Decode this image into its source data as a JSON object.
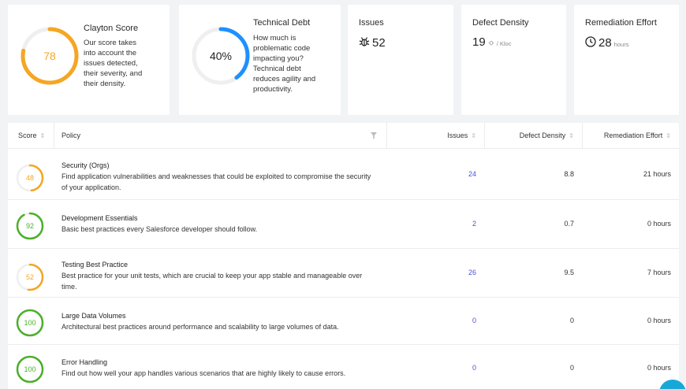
{
  "cards": {
    "score": {
      "value": "78",
      "fraction": 0.78,
      "title": "Clayton Score",
      "description": [
        "Our score takes",
        "into account the",
        "issues detected,",
        "their severity, and",
        "their density."
      ],
      "color": "#f5a623"
    },
    "debt": {
      "value": "40%",
      "fraction": 0.4,
      "title": "Technical Debt",
      "description": [
        "How much is",
        "problematic code",
        "impacting you?",
        "Technical debt",
        "reduces agility and",
        "productivity."
      ],
      "color": "#1e90ff"
    },
    "issues": {
      "title": "Issues",
      "value": "52",
      "icon": "bug-icon"
    },
    "density": {
      "title": "Defect Density",
      "value": "19",
      "unit": "/ Kloc",
      "icon": "bug-icon"
    },
    "remediation": {
      "title": "Remediation Effort",
      "value": "28",
      "unit": "hours",
      "icon": "clock-icon"
    }
  },
  "table": {
    "headers": {
      "score": "Score",
      "policy": "Policy",
      "issues": "Issues",
      "density": "Defect Density",
      "remediation": "Remediation Effort"
    },
    "rows": [
      {
        "score": "48",
        "score_fraction": 0.48,
        "color": "#f5a623",
        "title": "Security (Orgs)",
        "desc": [
          "Find application vulnerabilities and weaknesses that could be exploited to compromise the security",
          "of your application."
        ],
        "issues": "24",
        "density": "8.8",
        "remediation": "21 hours"
      },
      {
        "score": "92",
        "score_fraction": 0.92,
        "color": "#4caf2a",
        "title": "Development Essentials",
        "desc": [
          "Basic best practices every Salesforce developer should follow."
        ],
        "issues": "2",
        "density": "0.7",
        "remediation": "0 hours"
      },
      {
        "score": "52",
        "score_fraction": 0.52,
        "color": "#f5a623",
        "title": "Testing Best Practice",
        "desc": [
          "Best practice for your unit tests, which are crucial to keep your app stable and manageable over",
          "time."
        ],
        "issues": "26",
        "density": "9.5",
        "remediation": "7 hours"
      },
      {
        "score": "100",
        "score_fraction": 1.0,
        "color": "#4caf2a",
        "title": "Large Data Volumes",
        "desc": [
          "Architectural best practices around performance and scalability to large volumes of data."
        ],
        "issues": "0",
        "density": "0",
        "remediation": "0 hours"
      },
      {
        "score": "100",
        "score_fraction": 1.0,
        "color": "#4caf2a",
        "title": "Error Handling",
        "desc": [
          "Find out how well your app handles various scenarios that are highly likely to cause errors."
        ],
        "issues": "0",
        "density": "0",
        "remediation": "0 hours"
      }
    ]
  },
  "colors": {
    "link": "#4a4fd6",
    "chat": "#18a8d8"
  }
}
